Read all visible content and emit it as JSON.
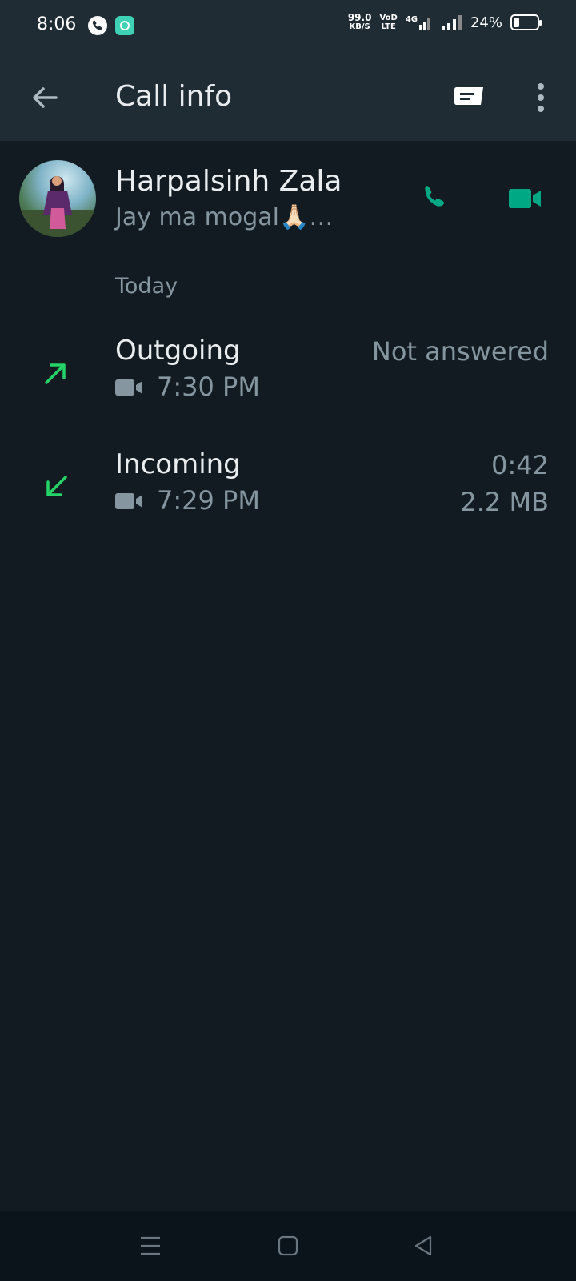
{
  "status_bar": {
    "time": "8:06",
    "net_speed_value": "99.0",
    "net_speed_unit": "KB/S",
    "vod_label": "VoD",
    "lte_label": "LTE",
    "network_label": "4G",
    "battery_percent": "24%",
    "battery_level": 0.24
  },
  "app_bar": {
    "title": "Call info",
    "back_icon": "arrow-left-icon",
    "chat_icon": "message-icon",
    "more_icon": "more-vert-icon"
  },
  "contact": {
    "name": "Harpalsinh Zala",
    "status": "Jay ma mogal🙏🏻…"
  },
  "colors": {
    "background": "#111b21",
    "app_bar": "#1f2c34",
    "accent_green": "#00a884",
    "arrow_green": "#25d366",
    "secondary_text": "#8696a0"
  },
  "section": {
    "label": "Today"
  },
  "calls": [
    {
      "type": "Outgoing",
      "direction": "outgoing",
      "time": "7:30 PM",
      "status": "Not answered",
      "size": ""
    },
    {
      "type": "Incoming",
      "direction": "incoming",
      "time": "7:29 PM",
      "status": "0:42",
      "size": "2.2 MB"
    }
  ]
}
